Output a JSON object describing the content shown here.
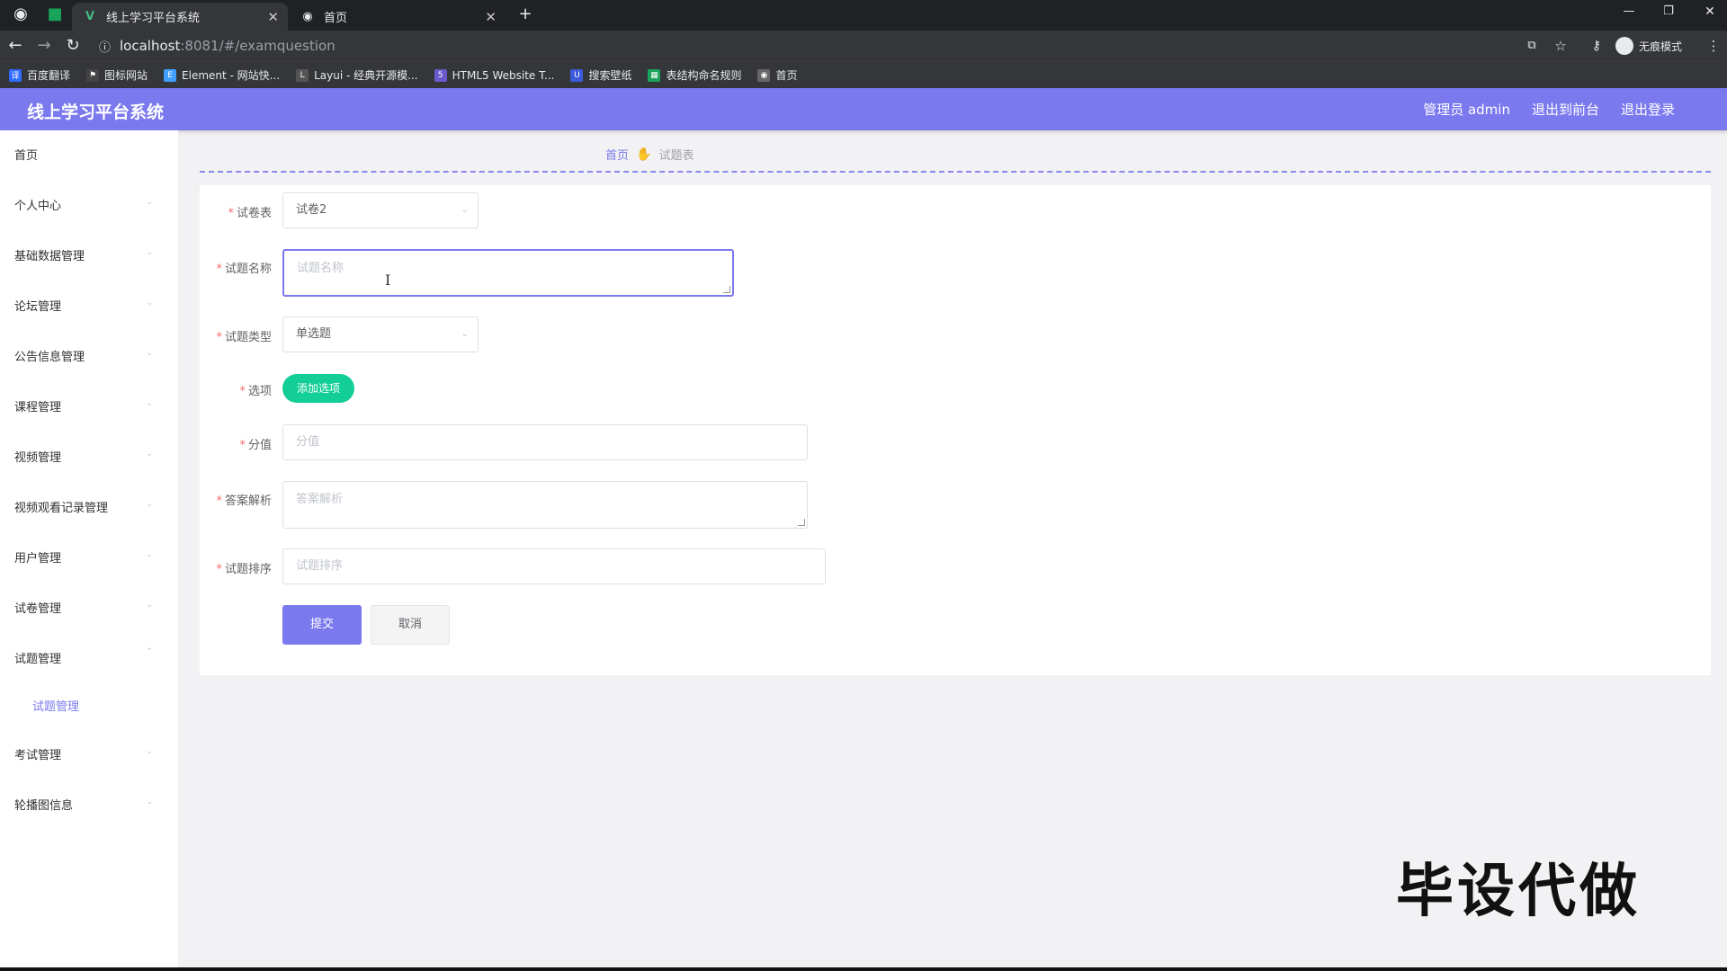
{
  "browser": {
    "tabs": [
      {
        "title": "线上学习平台系统",
        "active": true
      },
      {
        "title": "首页",
        "active": false
      }
    ],
    "new_tab": "+",
    "url_host": "localhost",
    "url_path": ":8081/#/examquestion",
    "incognito_label": "无痕模式",
    "bookmarks": [
      {
        "label": "百度翻译",
        "color": "#2f6bff"
      },
      {
        "label": "图标网站",
        "color": "#444"
      },
      {
        "label": "Element - 网站快...",
        "color": "#409eff"
      },
      {
        "label": "Layui - 经典开源模...",
        "color": "#555"
      },
      {
        "label": "HTML5 Website T...",
        "color": "#6a5acd"
      },
      {
        "label": "搜索壁纸",
        "color": "#3b5bdb"
      },
      {
        "label": "表结构命名规则",
        "color": "#19a35b"
      },
      {
        "label": "首页",
        "color": "#666"
      }
    ]
  },
  "header": {
    "title": "线上学习平台系统",
    "admin": "管理员 admin",
    "to_front": "退出到前台",
    "logout": "退出登录"
  },
  "sidebar": {
    "items": [
      "首页",
      "个人中心",
      "基础数据管理",
      "论坛管理",
      "公告信息管理",
      "课程管理",
      "视频管理",
      "视频观看记录管理",
      "用户管理",
      "试卷管理",
      "试题管理",
      "考试管理",
      "轮播图信息"
    ],
    "active_sub": "试题管理"
  },
  "breadcrumb": {
    "home": "首页",
    "current": "试题表"
  },
  "form": {
    "paper_label": "试卷表",
    "paper_value": "试卷2",
    "name_label": "试题名称",
    "name_placeholder": "试题名称",
    "type_label": "试题类型",
    "type_value": "单选题",
    "options_label": "选项",
    "add_option": "添加选项",
    "score_label": "分值",
    "score_placeholder": "分值",
    "analysis_label": "答案解析",
    "analysis_placeholder": "答案解析",
    "order_label": "试题排序",
    "order_placeholder": "试题排序",
    "submit": "提交",
    "cancel": "取消"
  },
  "watermark": "毕设代做",
  "colors": {
    "primary": "#7b79ee",
    "success": "#13ce96",
    "required": "#f56c6c"
  }
}
